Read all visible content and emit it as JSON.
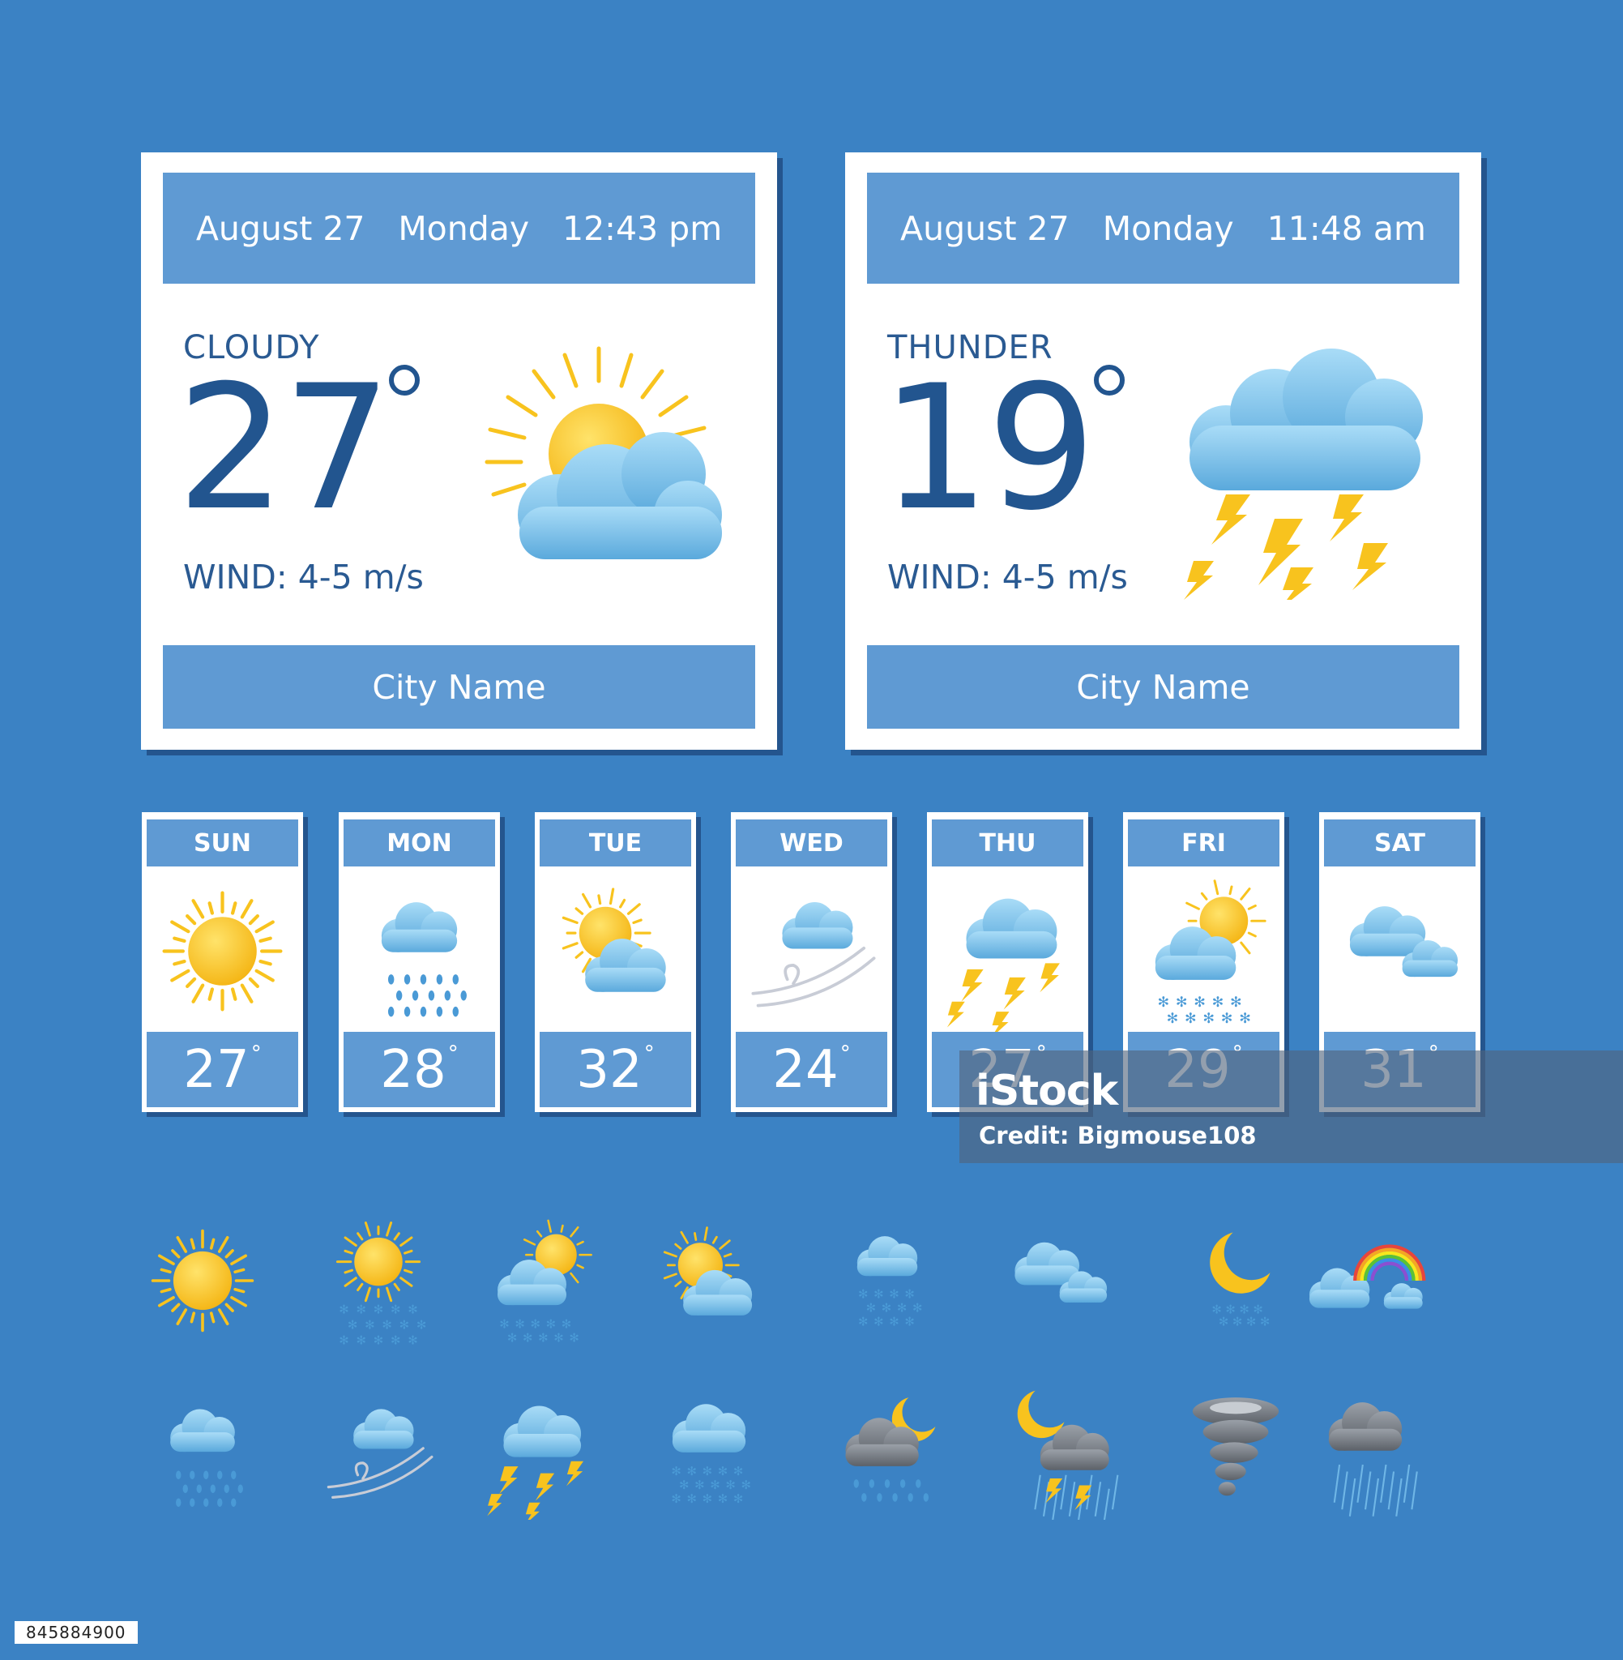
{
  "colors": {
    "background": "#3b82c4",
    "bar": "#5f9ad3",
    "text_dark": "#22558f",
    "sun": "#f8c31e",
    "cloud": "#7cc5ee",
    "storm_cloud": "#7a7f86"
  },
  "current_cards": [
    {
      "date": "August 27",
      "weekday": "Monday",
      "time": "12:43 pm",
      "condition": "CLOUDY",
      "temperature": "27",
      "wind": "WIND: 4-5 m/s",
      "city": "City Name",
      "icon": "sun-behind-cloud-icon"
    },
    {
      "date": "August 27",
      "weekday": "Monday",
      "time": "11:48 am",
      "condition": "THUNDER",
      "temperature": "19",
      "wind": "WIND: 4-5 m/s",
      "city": "City Name",
      "icon": "thunderstorm-icon"
    }
  ],
  "forecast": [
    {
      "day": "SUN",
      "temp": "27",
      "icon": "sun-icon"
    },
    {
      "day": "MON",
      "temp": "28",
      "icon": "rain-cloud-icon"
    },
    {
      "day": "TUE",
      "temp": "32",
      "icon": "sun-behind-cloud-icon"
    },
    {
      "day": "WED",
      "temp": "24",
      "icon": "windy-cloud-icon"
    },
    {
      "day": "THU",
      "temp": "27",
      "icon": "thunderstorm-icon"
    },
    {
      "day": "FRI",
      "temp": "29",
      "icon": "sun-cloud-snow-icon"
    },
    {
      "day": "SAT",
      "temp": "31",
      "icon": "two-clouds-icon"
    }
  ],
  "degree_symbol": "°",
  "icon_set": [
    "sun-icon",
    "sun-snow-icon",
    "sun-cloud-snow-icon",
    "sun-behind-cloud-icon",
    "snow-cloud-icon",
    "two-clouds-icon",
    "moon-snow-icon",
    "rainbow-clouds-icon",
    "rain-cloud-icon",
    "windy-cloud-icon",
    "thunderstorm-icon",
    "heavy-snow-cloud-icon",
    "night-rain-icon",
    "night-thunderstorm-icon",
    "tornado-icon",
    "heavy-rain-icon"
  ],
  "watermark": {
    "logo": "iStock",
    "credit": "Credit: Bigmouse108"
  },
  "image_id": "845884900"
}
